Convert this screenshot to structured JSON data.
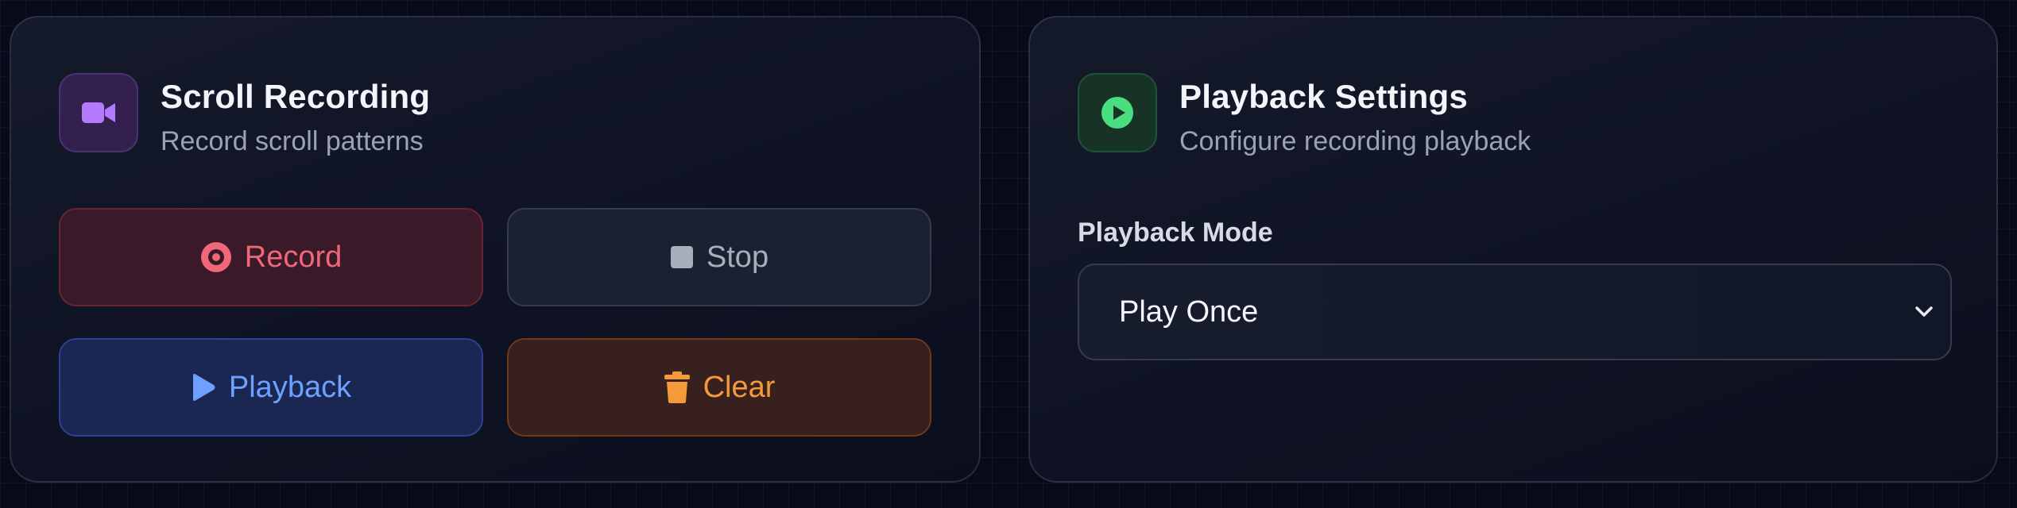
{
  "recording": {
    "title": "Scroll Recording",
    "subtitle": "Record scroll patterns",
    "icon": "video-camera-icon",
    "buttons": {
      "record": {
        "label": "Record",
        "icon": "record-icon",
        "color": "#f0677a"
      },
      "stop": {
        "label": "Stop",
        "icon": "stop-icon",
        "color": "#a8aebb"
      },
      "playback": {
        "label": "Playback",
        "icon": "play-icon",
        "color": "#6ea0ff"
      },
      "clear": {
        "label": "Clear",
        "icon": "trash-icon",
        "color": "#f59a3a"
      }
    }
  },
  "playback_settings": {
    "title": "Playback Settings",
    "subtitle": "Configure recording playback",
    "icon": "play-circle-icon",
    "mode_label": "Playback Mode",
    "mode_value": "Play Once"
  },
  "colors": {
    "accent_purple": "#b57bff",
    "accent_green": "#4ade80",
    "background": "#070a18"
  }
}
